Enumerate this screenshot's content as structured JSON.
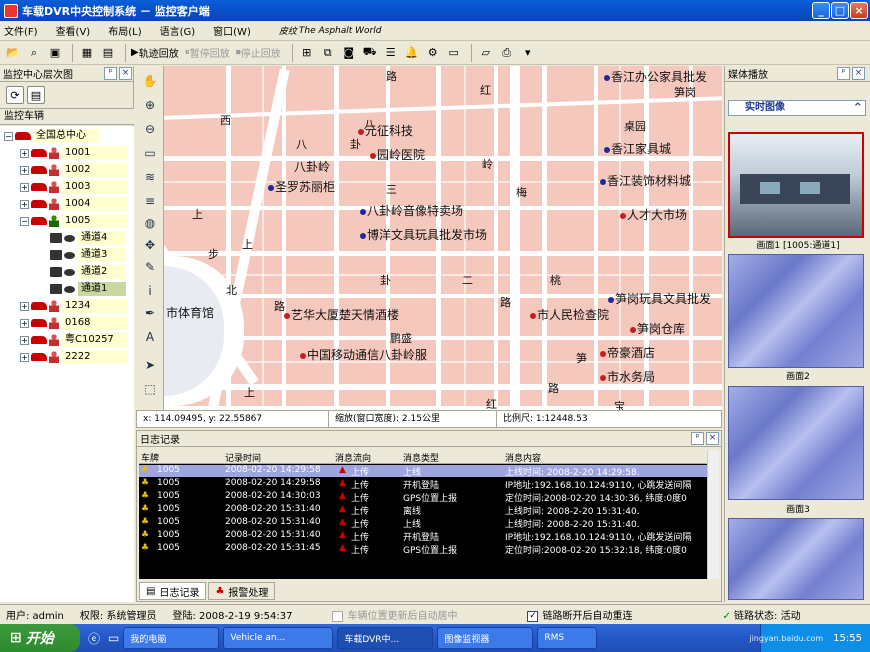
{
  "window": {
    "title": "车载DVR中央控制系统 － 监控客户端"
  },
  "menu": {
    "items": [
      "文件(F)",
      "查看(V)",
      "布局(L)",
      "语言(G)",
      "窗口(W)"
    ],
    "logo_text": "The Asphalt World",
    "logo_prefix": "皮纹"
  },
  "toolbar": {
    "track_play": "轨迹回放",
    "pause_play": "暂停回放",
    "stop_play": "停止回放"
  },
  "left_panel": {
    "title": "监控中心层次图",
    "tree_title": "监控车辆",
    "root": "全国总中心",
    "vehicles": [
      "1001",
      "1002",
      "1003",
      "1004",
      "1005"
    ],
    "channels": [
      "通道4",
      "通道3",
      "通道2",
      "通道1"
    ],
    "vehicles2": [
      "1234",
      "0168",
      "粤C10257",
      "2222"
    ]
  },
  "map": {
    "labels": {
      "l1": "路",
      "l2": "红",
      "l3": "香江办公家具批发",
      "l4": "笋岗",
      "l5": "元征科技",
      "l6": "八",
      "l7": "卦",
      "l8": "园岭医院",
      "l9": "八卦岭",
      "l10": "三",
      "l11": "岭",
      "l12": "梅",
      "l13": "香江家具城",
      "l14": "圣罗苏丽柜",
      "l15": "香江装饰材料城",
      "l16": "八卦岭音像特卖场",
      "l17": "人才大市场",
      "l18": "博洋文具玩具批发市场",
      "l19": "上",
      "l20": "步",
      "l21": "卦",
      "l22": "二",
      "l23": "路",
      "l24": "桃",
      "l25": "北",
      "l26": "市体育馆",
      "l27": "艺华大厦楚天情酒楼",
      "l28": "市人民检查院",
      "l29": "笋岗玩具文具批发",
      "l30": "笋岗仓库",
      "l31": "帝豪酒店",
      "l32": "鹏盛",
      "l33": "中国移动通信八卦岭服",
      "l34": "市水务局",
      "l35": "西",
      "l36": "上",
      "l37": "八",
      "l38": "路",
      "l39": "上",
      "l40": "红",
      "l41": "路",
      "l42": "宝",
      "l43": "笋",
      "l44": "桌园"
    }
  },
  "map_status": {
    "coords": "x: 114.09495, y: 22.55867",
    "zoom": "缩放(窗口宽度): 2.15公里",
    "scale": "比例尺: 1:12448.53"
  },
  "log": {
    "title": "日志记录",
    "headers": [
      "车牌",
      "记录时间",
      "消息流向",
      "消息类型",
      "消息内容"
    ],
    "rows": [
      [
        "1005",
        "2008-02-20 14:29:58",
        "上传",
        "上线",
        "上线时间: 2008-2-20 14:29:58."
      ],
      [
        "1005",
        "2008-02-20 14:29:58",
        "上传",
        "开机登陆",
        "IP地址:192.168.10.124:9110, 心跳发送间隔"
      ],
      [
        "1005",
        "2008-02-20 14:30:03",
        "上传",
        "GPS位置上报",
        "定位时间:2008-02-20 14:30:36, 纬度:0度0"
      ],
      [
        "1005",
        "2008-02-20 15:31:40",
        "上传",
        "离线",
        "上线时间: 2008-2-20 15:31:40."
      ],
      [
        "1005",
        "2008-02-20 15:31:40",
        "上传",
        "上线",
        "上线时间: 2008-2-20 15:31:40."
      ],
      [
        "1005",
        "2008-02-20 15:31:40",
        "上传",
        "开机登陆",
        "IP地址:192.168.10.124:9110, 心跳发送间隔"
      ],
      [
        "1005",
        "2008-02-20 15:31:45",
        "上传",
        "GPS位置上报",
        "定位时间:2008-02-20 15:32:18, 纬度:0度0"
      ]
    ],
    "tabs": [
      "日志记录",
      "报警处理"
    ]
  },
  "right_panel": {
    "title": "媒体播放",
    "live_label": "实时图像",
    "screens": [
      "画面1 [1005:通道1]",
      "画面2",
      "画面3"
    ]
  },
  "status_bar": {
    "user": "用户: admin",
    "role": "权限: 系统管理员",
    "login": "登陆: 2008-2-19 9:54:37",
    "auto_center": "车辆位置更新后自动居中",
    "auto_reconnect": "链路断开后自动重连",
    "link_status": "链路状态: 活动"
  },
  "taskbar": {
    "start": "开始",
    "tasks": [
      "我的电脑",
      "Vehicle an...",
      "车载DVR中...",
      "图像监视器",
      "RMS"
    ],
    "clock": "15:55",
    "watermark": "jingyan.baidu.com"
  },
  "colors": {
    "titlebar": "#0850c8",
    "map_bg": "#f5c8bd",
    "log_bg": "#000000",
    "selected_row": "#9fa5de",
    "tree_label": "#ffffd0"
  }
}
